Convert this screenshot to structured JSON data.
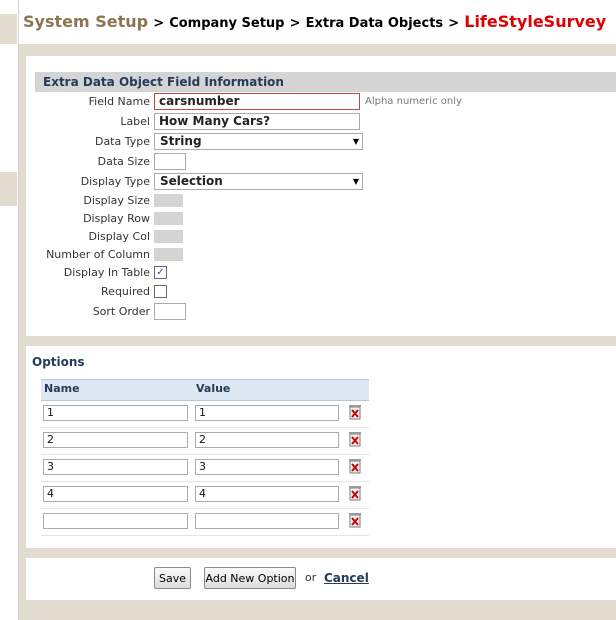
{
  "breadcrumb": {
    "root": "System Setup",
    "sep": ">",
    "level1": "Company Setup",
    "level2": "Extra Data Objects",
    "current": "LifeStyleSurvey"
  },
  "field_info": {
    "title": "Extra Data Object Field Information",
    "field_name_label": "Field Name",
    "field_name_value": "carsnumber",
    "field_name_hint": "Alpha numeric only",
    "label_label": "Label",
    "label_value": "How Many Cars?",
    "data_type_label": "Data Type",
    "data_type_value": "String",
    "data_size_label": "Data Size",
    "data_size_value": "",
    "display_type_label": "Display Type",
    "display_type_value": "Selection",
    "display_size_label": "Display Size",
    "display_row_label": "Display Row",
    "display_col_label": "Display Col",
    "number_of_column_label": "Number of Column",
    "display_in_table_label": "Display In Table",
    "display_in_table_checked": true,
    "required_label": "Required",
    "required_checked": false,
    "sort_order_label": "Sort Order",
    "sort_order_value": ""
  },
  "options": {
    "title": "Options",
    "col_name": "Name",
    "col_value": "Value",
    "rows": [
      {
        "name": "1",
        "value": "1"
      },
      {
        "name": "2",
        "value": "2"
      },
      {
        "name": "3",
        "value": "3"
      },
      {
        "name": "4",
        "value": "4"
      },
      {
        "name": "",
        "value": ""
      }
    ]
  },
  "actions": {
    "save": "Save",
    "add_option": "Add New Option",
    "or": "or",
    "cancel": "Cancel"
  },
  "icons": {
    "delete": "delete-icon",
    "dropdown": "chevron-down-icon",
    "check": "checkmark-icon"
  },
  "colors": {
    "breadcrumb_root": "#8a7652",
    "breadcrumb_current": "#e00000",
    "background": "#e2dbd0",
    "section_header": "#d4d4d4",
    "heading_text": "#243b59"
  }
}
